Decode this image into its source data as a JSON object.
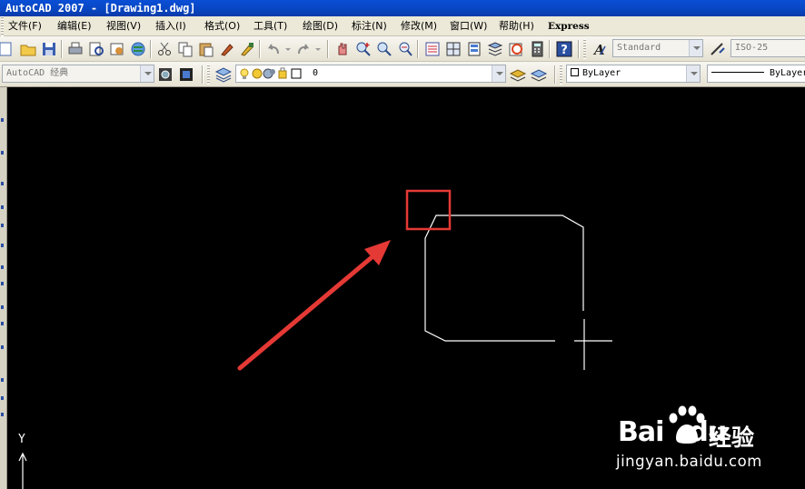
{
  "window": {
    "title": "AutoCAD 2007 - [Drawing1.dwg]"
  },
  "menu": {
    "items": [
      "文件(F)",
      "编辑(E)",
      "视图(V)",
      "插入(I)",
      "格式(O)",
      "工具(T)",
      "绘图(D)",
      "标注(N)",
      "修改(M)",
      "窗口(W)",
      "帮助(H)",
      "Express"
    ]
  },
  "toolbar2": {
    "workspace": "AutoCAD 经典",
    "layer_value": "0",
    "color_value": "ByLayer",
    "linetype_value": "ByLayer"
  },
  "styles": {
    "text_style": "Standard",
    "dim_style": "ISO-25"
  },
  "canvas": {
    "ucs_label": "Y",
    "background": "#000000",
    "line_color": "#ffffff",
    "annotation_color": "#e53935"
  },
  "watermark": {
    "brand": "Bai",
    "brand_tail": "du",
    "cn": "经验",
    "url": "jingyan.baidu.com"
  }
}
